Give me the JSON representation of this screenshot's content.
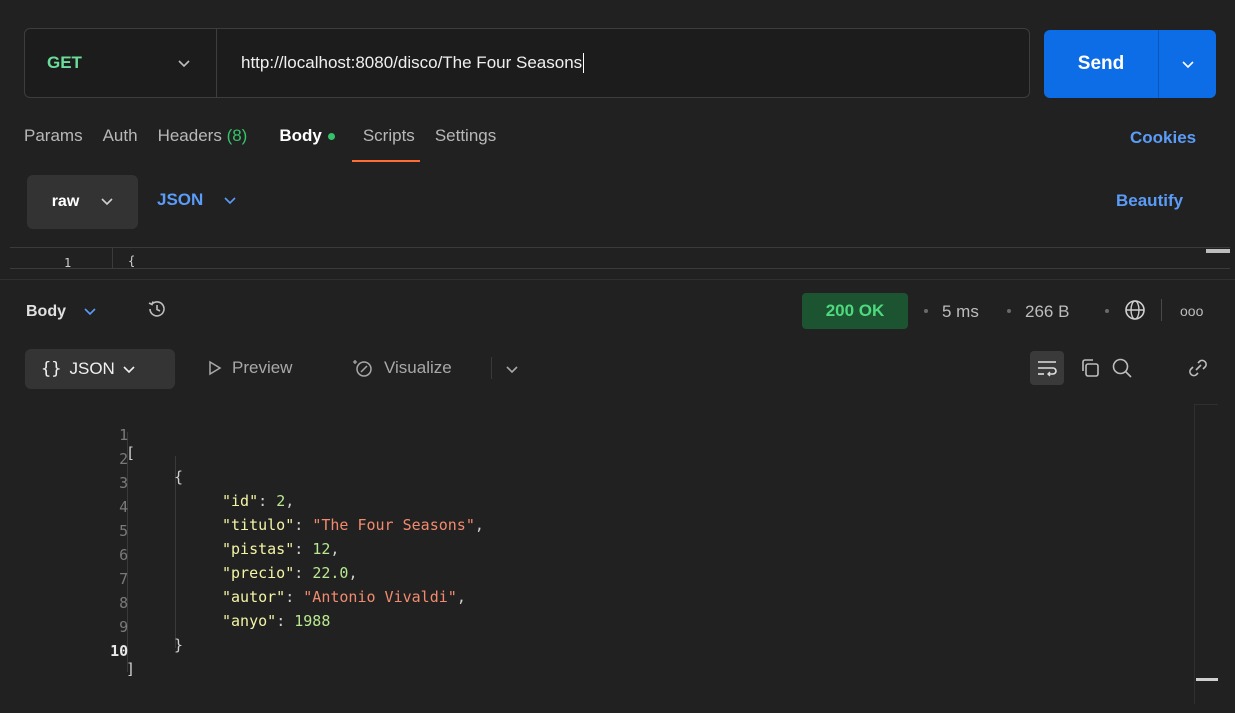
{
  "request": {
    "method": "GET",
    "url": "http://localhost:8080/disco/The Four Seasons",
    "send_label": "Send"
  },
  "tabs": [
    {
      "label": "Params"
    },
    {
      "label": "Auth"
    },
    {
      "label": "Headers",
      "count": "(8)"
    },
    {
      "label": "Body",
      "active": true
    },
    {
      "label": "Scripts"
    },
    {
      "label": "Settings"
    }
  ],
  "cookies_label": "Cookies",
  "body_mode": {
    "raw_label": "raw",
    "format_label": "JSON"
  },
  "beautify_label": "Beautify",
  "request_editor": {
    "line": "1",
    "text": "{"
  },
  "response": {
    "body_label": "Body",
    "status": "200 OK",
    "time": "5 ms",
    "size": "266 B",
    "more": "ooo",
    "view_label": "JSON",
    "view_braces": "{}",
    "preview_label": "Preview",
    "visualize_label": "Visualize",
    "lines": [
      {
        "n": "1",
        "text": "["
      },
      {
        "n": "2",
        "text": "{"
      },
      {
        "n": "3",
        "key": "\"id\"",
        "value": "2",
        "type": "num"
      },
      {
        "n": "4",
        "key": "\"titulo\"",
        "value": "\"The Four Seasons\"",
        "type": "str"
      },
      {
        "n": "5",
        "key": "\"pistas\"",
        "value": "12",
        "type": "num"
      },
      {
        "n": "6",
        "key": "\"precio\"",
        "value": "22.0",
        "type": "num"
      },
      {
        "n": "7",
        "key": "\"autor\"",
        "value": "\"Antonio Vivaldi\"",
        "type": "str"
      },
      {
        "n": "8",
        "key": "\"anyo\"",
        "value": "1988",
        "type": "num",
        "last": true
      },
      {
        "n": "9",
        "text": "}"
      },
      {
        "n": "10",
        "text": "]"
      }
    ]
  },
  "colors": {
    "accent": "#0d6de6",
    "method": "#6bdd9a",
    "status_bg": "#1c5431",
    "tab_underline": "#ff6c37"
  }
}
